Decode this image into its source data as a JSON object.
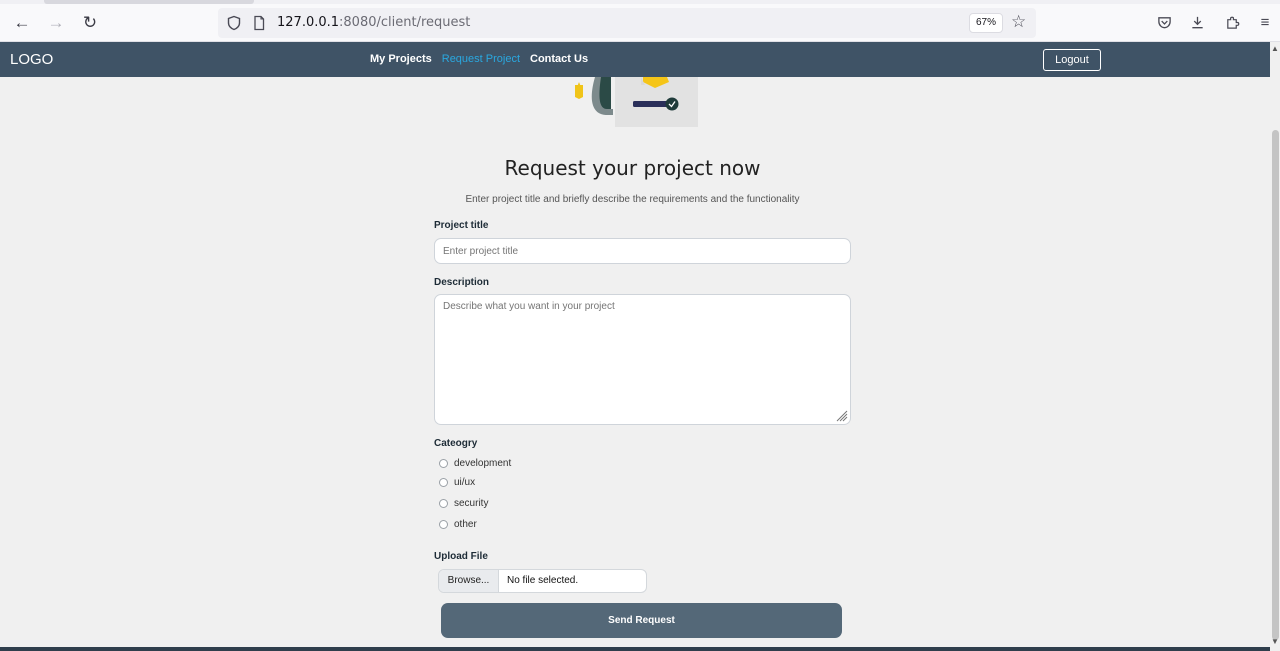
{
  "browser": {
    "url_host": "127.0.0.1",
    "url_rest": ":8080/client/request",
    "zoom": "67%"
  },
  "navbar": {
    "logo": "LOGO",
    "links": [
      "My Projects",
      "Request Project",
      "Contact Us"
    ],
    "active_link": "Request Project",
    "logout_label": "Logout"
  },
  "form": {
    "heading": "Request your project now",
    "subtext": "Enter project title and briefly describe the requirements and the functionality",
    "title_label": "Project title",
    "title_placeholder": "Enter project title",
    "description_label": "Description",
    "description_placeholder": "Describe what you want in your project",
    "category_label": "Cateogry",
    "categories": [
      "development",
      "ui/ux",
      "security",
      "other"
    ],
    "upload_label": "Upload File",
    "browse_label": "Browse...",
    "file_status": "No file selected.",
    "submit_label": "Send Request"
  },
  "colors": {
    "navbar_bg": "#3f5366",
    "active_link": "#2aa8e0",
    "submit_bg": "#546878"
  }
}
